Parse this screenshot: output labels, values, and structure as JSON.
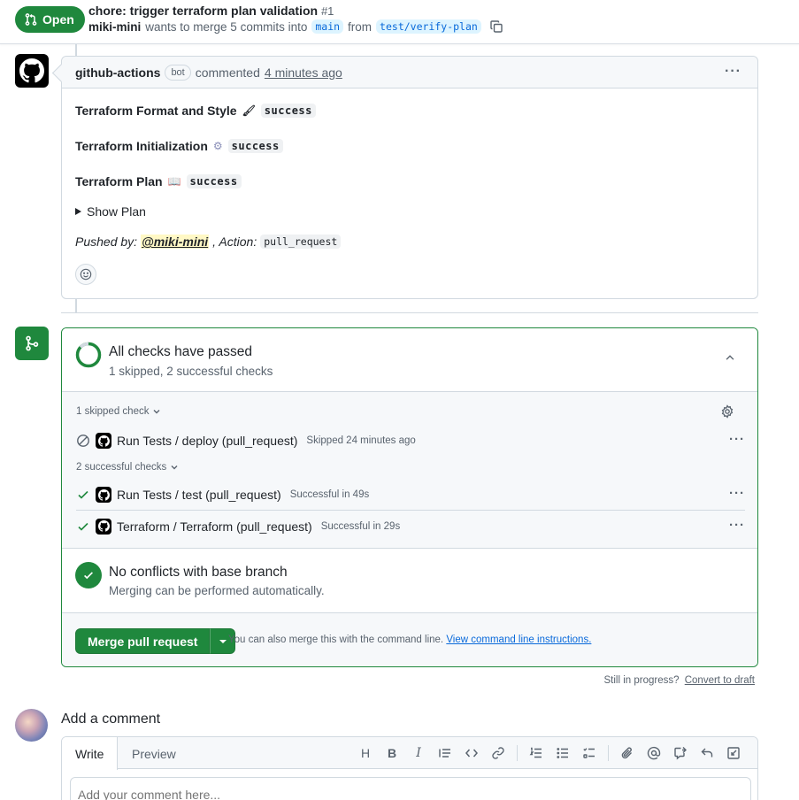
{
  "pr": {
    "state": "Open",
    "title": "chore: trigger terraform plan validation",
    "number": "#1",
    "author": "miki-mini",
    "merge_text": "wants to merge 5 commits into",
    "base_branch": "main",
    "from_text": "from",
    "head_branch": "test/verify-plan"
  },
  "comment": {
    "user": "github-actions",
    "bot_label": "bot",
    "action": "commented",
    "time": "4 minutes ago",
    "lines": [
      {
        "label": "Terraform Format and Style",
        "emoji": "🖌",
        "status": "success"
      },
      {
        "label": "Terraform Initialization",
        "emoji": "⚙",
        "status": "success"
      },
      {
        "label": "Terraform Plan",
        "emoji": "📖",
        "status": "success"
      }
    ],
    "show_plan": "Show Plan",
    "pushed_by_label": "Pushed by:",
    "pushed_by_user": "@miki-mini",
    "action_label": ", Action:",
    "action_value": "pull_request"
  },
  "checks": {
    "title": "All checks have passed",
    "subtitle": "1 skipped, 2 successful checks",
    "skipped_group": "1 skipped check",
    "successful_group": "2 successful checks",
    "items": [
      {
        "name": "Run Tests / deploy (pull_request)",
        "status": "Skipped 24 minutes ago"
      },
      {
        "name": "Run Tests / test (pull_request)",
        "status": "Successful in 49s"
      },
      {
        "name": "Terraform / Terraform (pull_request)",
        "status": "Successful in 29s"
      }
    ]
  },
  "conflicts": {
    "title": "No conflicts with base branch",
    "subtitle": "Merging can be performed automatically."
  },
  "merge": {
    "button": "Merge pull request",
    "hint": "You can also merge this with the command line.",
    "hint_link": "View command line instructions."
  },
  "draft": {
    "text": "Still in progress?",
    "link": "Convert to draft"
  },
  "add_comment": {
    "title": "Add a comment",
    "tab_write": "Write",
    "tab_preview": "Preview",
    "placeholder": "Add your comment here...",
    "toolbar": [
      "H",
      "B",
      "I"
    ]
  },
  "colors": {
    "success_green": "#1f883d",
    "link_blue": "#0969da",
    "muted": "#59636e",
    "border": "#d1d9e0"
  }
}
